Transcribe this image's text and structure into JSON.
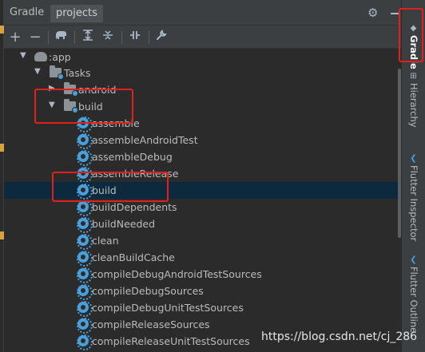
{
  "header": {
    "tab_gradle": "Gradle",
    "tab_projects": "projects"
  },
  "toolbar": {
    "buttons": [
      "plus-icon",
      "minus-icon",
      "elephant-icon",
      "expand-all-icon",
      "collapse-all-icon",
      "toggle-offline-icon",
      "wrench-icon"
    ]
  },
  "tree": {
    "app": ":app",
    "tasks": "Tasks",
    "android": "android",
    "build_group": "build",
    "items": [
      "assemble",
      "assembleAndroidTest",
      "assembleDebug",
      "assembleRelease",
      "build",
      "buildDependents",
      "buildNeeded",
      "clean",
      "cleanBuildCache",
      "compileDebugAndroidTestSources",
      "compileDebugSources",
      "compileDebugUnitTestSources",
      "compileReleaseSources",
      "compileReleaseUnitTestSources"
    ],
    "selected_item": "build"
  },
  "right_tabs": {
    "gradle": "Gradle",
    "hierarchy": "Hierarchy",
    "flutter_inspector": "Flutter Inspector",
    "flutter_outline": "Flutter Outline"
  },
  "watermark": "https://blog.csdn.net/cj_286",
  "colors": {
    "selection": "#0d293e",
    "gear": "#4a9fd8",
    "highlight": "#e0201a"
  }
}
